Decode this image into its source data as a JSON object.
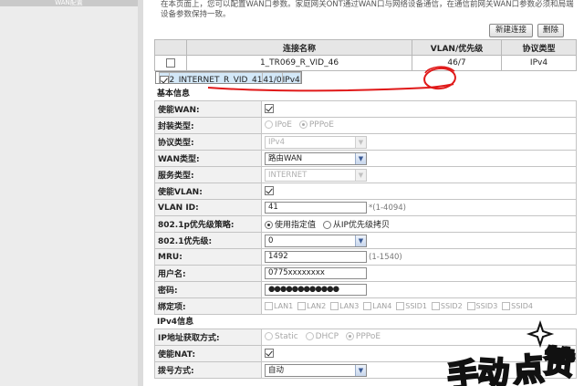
{
  "nav": {
    "active_tab": "WAN配置"
  },
  "notice": "在本页面上，您可以配置WAN口参数。家庭网关ONT通过WAN口与网络设备通信，在通信前网关WAN口参数必须和局端设备参数保持一致。",
  "toolbar": {
    "new_label": "新建连接",
    "delete_label": "删除"
  },
  "connections": {
    "headers": [
      "",
      "连接名称",
      "VLAN/优先级",
      "协议类型"
    ],
    "rows": [
      {
        "checked": false,
        "name": "1_TR069_R_VID_46",
        "vlan": "46/7",
        "protocol": "IPv4"
      },
      {
        "checked": true,
        "name": "2_INTERNET_R_VID_41",
        "vlan": "41/0",
        "protocol": "IPv4"
      }
    ]
  },
  "basic": {
    "section_title": "基本信息",
    "enable_wan_label": "使能WAN:",
    "encap_label": "封装类型:",
    "encap_options": [
      "IPoE",
      "PPPoE"
    ],
    "protocol_label": "协议类型:",
    "protocol_value": "IPv4",
    "wan_type_label": "WAN类型:",
    "wan_type_value": "路由WAN",
    "service_label": "服务类型:",
    "service_value": "INTERNET",
    "enable_vlan_label": "使能VLAN:",
    "vlan_id_label": "VLAN ID:",
    "vlan_id_value": "41",
    "vlan_id_hint": "*(1-4094)",
    "prio_policy_label": "802.1p优先级策略:",
    "prio_policy_options": [
      "使用指定值",
      "从IP优先级拷贝"
    ],
    "prio_label": "802.1优先级:",
    "prio_value": "0",
    "mru_label": "MRU:",
    "mru_value": "1492",
    "mru_hint": "(1-1540)",
    "username_label": "用户名:",
    "username_value": "0775xxxxxxxx",
    "password_label": "密码:",
    "password_value": "●●●●●●●●●●●●",
    "bind_label": "绑定项:",
    "bind_options": [
      "LAN1",
      "LAN2",
      "LAN3",
      "LAN4",
      "SSID1",
      "SSID2",
      "SSID3",
      "SSID4"
    ]
  },
  "ipv4": {
    "section_title": "IPv4信息",
    "addr_mode_label": "IP地址获取方式:",
    "addr_mode_options": [
      "Static",
      "DHCP",
      "PPPoE"
    ],
    "nat_label": "使能NAT:",
    "dial_label": "拨号方式:",
    "dial_value": "自动"
  },
  "colors": {
    "annotation": "#e01818",
    "selected_row": "#d3e8f8"
  },
  "watermark": "手动点赞"
}
